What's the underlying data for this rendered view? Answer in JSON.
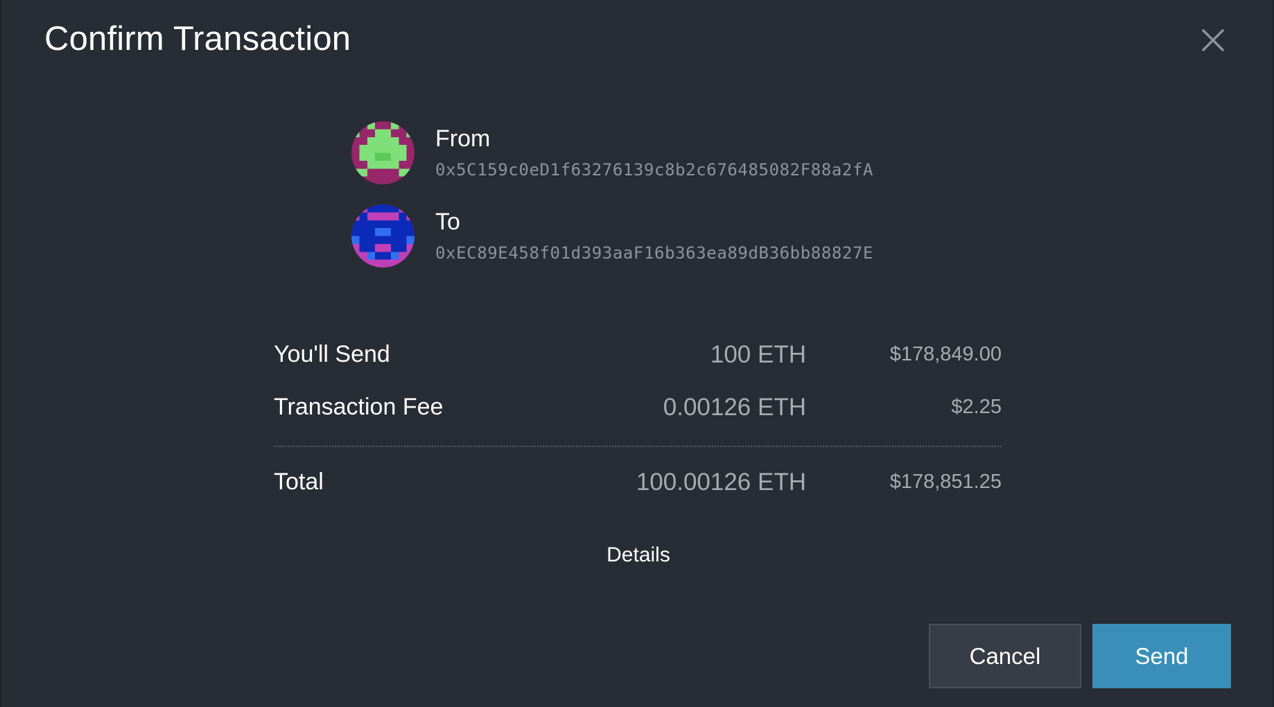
{
  "dialog": {
    "title": "Confirm Transaction",
    "close_icon": "close-icon"
  },
  "from": {
    "label": "From",
    "address": "0x5C159c0eD1f63276139c8b2c676485082F88a2fA",
    "avatar_colors": [
      "#97266b",
      "#7fe07a",
      "#5cc95a"
    ]
  },
  "to": {
    "label": "To",
    "address": "0xEC89E458f01d393aaF16b363ea89dB36bb88827E",
    "avatar_colors": [
      "#c040b8",
      "#0c2ab8",
      "#2f6ff0"
    ]
  },
  "summary": {
    "send": {
      "label": "You'll Send",
      "eth": "100 ETH",
      "usd": "$178,849.00"
    },
    "fee": {
      "label": "Transaction Fee",
      "eth": "0.00126 ETH",
      "usd": "$2.25"
    },
    "total": {
      "label": "Total",
      "eth": "100.00126 ETH",
      "usd": "$178,851.25"
    }
  },
  "details_label": "Details",
  "buttons": {
    "cancel": "Cancel",
    "send": "Send"
  },
  "colors": {
    "background": "#282c34",
    "primary_button": "#3a8fb8",
    "secondary_button": "#383c46"
  }
}
